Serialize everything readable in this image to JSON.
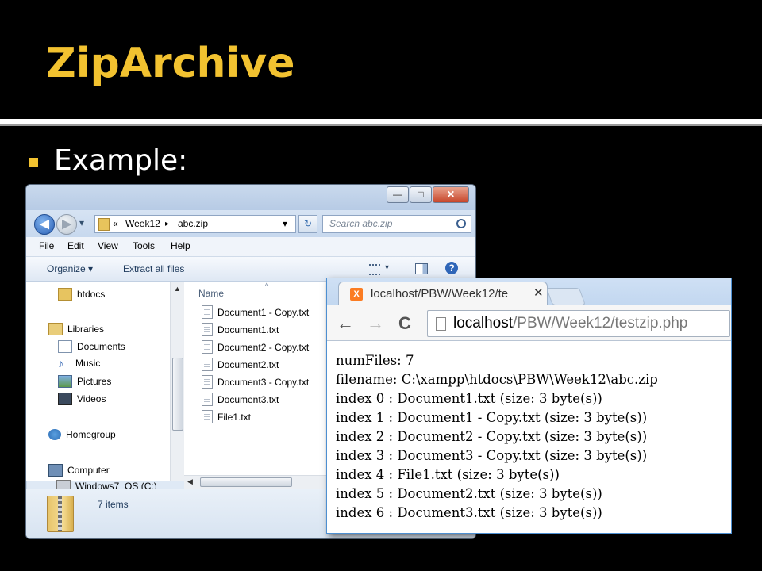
{
  "slide": {
    "title": "ZipArchive",
    "bullet": "Example:",
    "colors": {
      "title": "#f2c230",
      "background": "#000000",
      "bullet": "#f2c230"
    }
  },
  "explorer": {
    "window_buttons": {
      "minimize": "—",
      "maximize": "□",
      "close": "✕"
    },
    "nav": {
      "back": "◀",
      "forward": "▶",
      "dropdown": "▾"
    },
    "breadcrumb": {
      "chevrons": "«",
      "folder": "Week12",
      "separator": "▸",
      "file": "abc.zip",
      "dropdown": "▾"
    },
    "refresh": "↻",
    "search_placeholder": "Search abc.zip",
    "menu": [
      "File",
      "Edit",
      "View",
      "Tools",
      "Help"
    ],
    "commands": {
      "organize": "Organize ▾",
      "extract": "Extract all files"
    },
    "sidebar": {
      "items": [
        {
          "label": "htdocs",
          "icon": "folder-icon"
        },
        {
          "label": "Libraries",
          "icon": "library-icon"
        },
        {
          "label": "Documents",
          "icon": "documents-icon"
        },
        {
          "label": "Music",
          "icon": "music-icon"
        },
        {
          "label": "Pictures",
          "icon": "pictures-icon"
        },
        {
          "label": "Videos",
          "icon": "videos-icon"
        },
        {
          "label": "Homegroup",
          "icon": "homegroup-icon"
        },
        {
          "label": "Computer",
          "icon": "computer-icon"
        },
        {
          "label": "Windows7_OS (C:)",
          "icon": "drive-icon"
        }
      ]
    },
    "file_list": {
      "column_name": "Name",
      "files": [
        "Document1 - Copy.txt",
        "Document1.txt",
        "Document2 - Copy.txt",
        "Document2.txt",
        "Document3 - Copy.txt",
        "Document3.txt",
        "File1.txt"
      ]
    },
    "status": {
      "item_count": "7 items"
    }
  },
  "browser": {
    "tab": {
      "title": "localhost/PBW/Week12/te",
      "close": "✕",
      "favicon": "X"
    },
    "toolbar": {
      "back": "←",
      "forward": "→",
      "reload": "C"
    },
    "url": {
      "host": "localhost",
      "path": "/PBW/Week12/testzip.php"
    },
    "output_lines": [
      "numFiles: 7",
      "filename: C:\\xampp\\htdocs\\PBW\\Week12\\abc.zip",
      "index 0 : Document1.txt (size: 3 byte(s))",
      "index 1 : Document1 - Copy.txt (size: 3 byte(s))",
      "index 2 : Document2 - Copy.txt (size: 3 byte(s))",
      "index 3 : Document3 - Copy.txt (size: 3 byte(s))",
      "index 4 : File1.txt (size: 3 byte(s))",
      "index 5 : Document2.txt (size: 3 byte(s))",
      "index 6 : Document3.txt (size: 3 byte(s))"
    ]
  }
}
